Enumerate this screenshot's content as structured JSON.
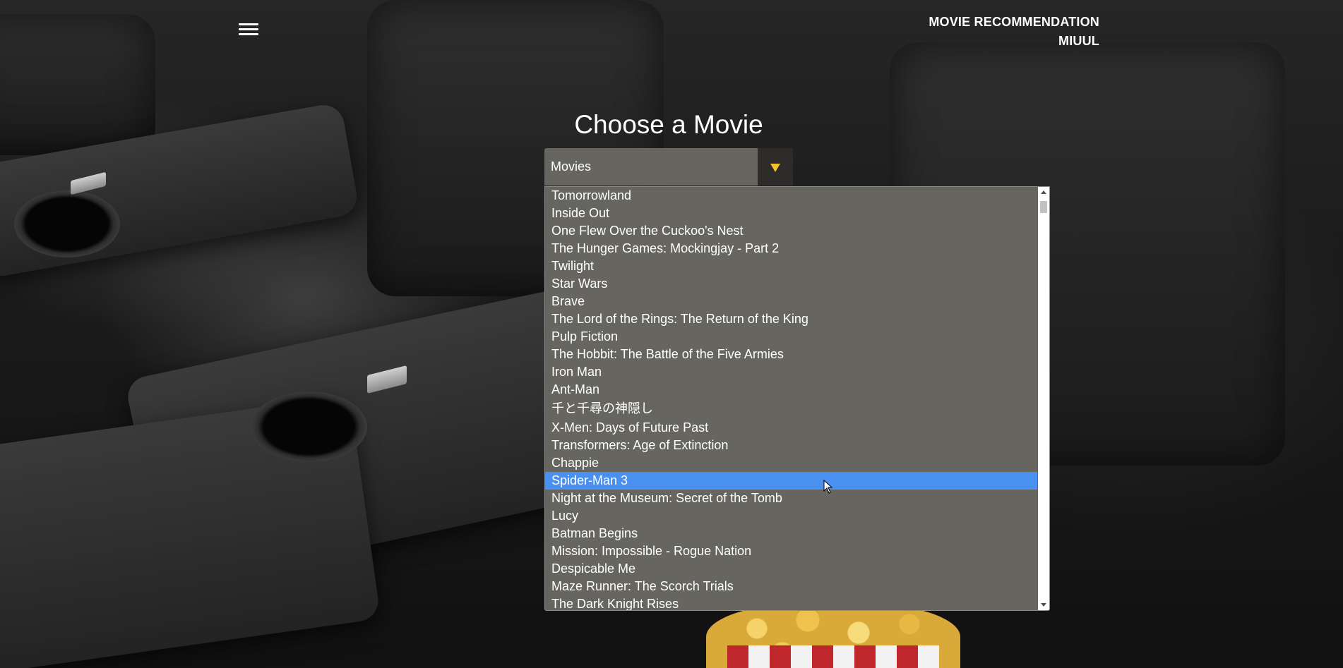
{
  "header": {
    "brand_line1": "MOVIE RECOMMENDATION",
    "brand_line2": "MIUUL",
    "menu_icon": "hamburger-menu-icon"
  },
  "main": {
    "title": "Choose a Movie",
    "select": {
      "value": "Movies",
      "arrow_icon": "dropdown-triangle-icon",
      "arrow_color": "#f2c12e"
    },
    "dropdown": {
      "selected_index": 16,
      "options": [
        "Tomorrowland",
        "Inside Out",
        "One Flew Over the Cuckoo's Nest",
        "The Hunger Games: Mockingjay - Part 2",
        "Twilight",
        "Star Wars",
        "Brave",
        "The Lord of the Rings: The Return of the King",
        "Pulp Fiction",
        "The Hobbit: The Battle of the Five Armies",
        "Iron Man",
        "Ant-Man",
        "千と千尋の神隠し",
        "X-Men: Days of Future Past",
        "Transformers: Age of Extinction",
        "Chappie",
        "Spider-Man 3",
        "Night at the Museum: Secret of the Tomb",
        "Lucy",
        "Batman Begins",
        "Mission: Impossible - Rogue Nation",
        "Despicable Me",
        "Maze Runner: The Scorch Trials",
        "The Dark Knight Rises"
      ]
    }
  },
  "colors": {
    "panel": "#66655f",
    "selection": "#4a90f0",
    "text": "#ffffff"
  }
}
